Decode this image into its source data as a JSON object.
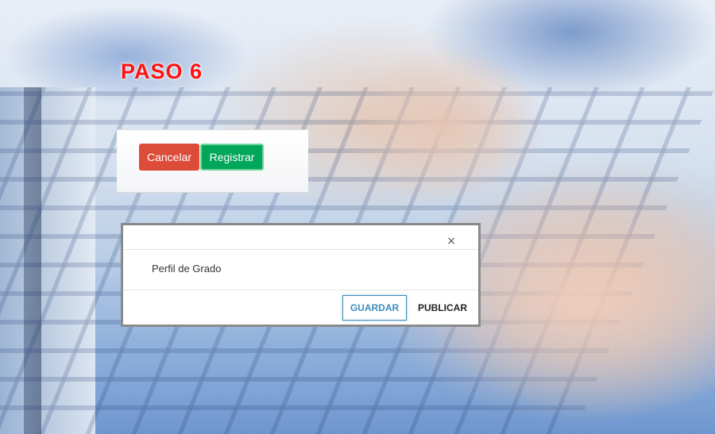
{
  "step": {
    "title": "PASO 6"
  },
  "toolbar": {
    "cancel_label": "Cancelar",
    "register_label": "Registrar"
  },
  "modal": {
    "close_symbol": "×",
    "body_text": "Perfil de Grado",
    "save_label": "GUARDAR",
    "publish_label": "PUBLICAR"
  },
  "colors": {
    "title": "#ff1111",
    "cancel_button": "#dd4b39",
    "register_button": "#00a65a",
    "save_accent": "#3c8dbc"
  }
}
